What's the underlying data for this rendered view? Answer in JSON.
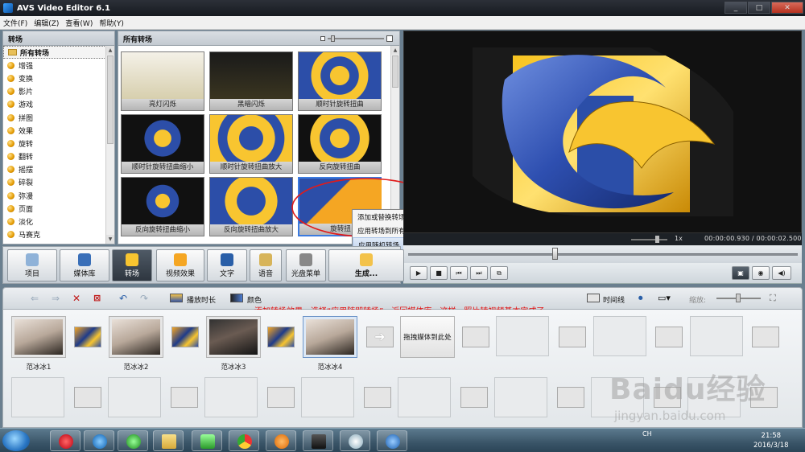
{
  "window": {
    "title": "AVS Video Editor 6.1"
  },
  "menu": [
    "文件(F)",
    "编辑(Z)",
    "查看(W)",
    "帮助(Y)"
  ],
  "left_panel": {
    "header": "转场",
    "categories": [
      "所有转场",
      "增强",
      "变换",
      "影片",
      "游戏",
      "拼图",
      "效果",
      "旋转",
      "翻转",
      "摇摆",
      "碎裂",
      "弥漫",
      "页面",
      "淡化",
      "马赛克"
    ]
  },
  "transitions_panel": {
    "header": "所有转场",
    "items": [
      "亮灯闪烁",
      "黑暗闪烁",
      "顺时针旋转扭曲",
      "顺时针旋转扭曲缩小",
      "顺时针旋转扭曲放大",
      "反向旋转扭曲",
      "反向旋转扭曲缩小",
      "反向旋转扭曲放大",
      "旋转扭"
    ]
  },
  "context_menu": {
    "items": [
      "添加或替换转场",
      "应用转场到所有的",
      "应用随机转场"
    ],
    "highlighted": 2
  },
  "preview": {
    "speed": "1x",
    "time_current": "00:00:00.930",
    "time_total": "00:00:02.500",
    "seek_fraction": 0.37
  },
  "mode_buttons": [
    {
      "label": "项目"
    },
    {
      "label": "媒体库"
    },
    {
      "label": "转场",
      "active": true
    },
    {
      "label": "视频效果"
    },
    {
      "label": "文字"
    },
    {
      "label": "语音"
    },
    {
      "label": "光盘菜单"
    },
    {
      "label": "生成..."
    }
  ],
  "playback_buttons": [
    "▶",
    "■",
    "⏮",
    "⏭",
    "⧉"
  ],
  "timeline_toolbar": {
    "duration_label": "播放时长",
    "color_label": "颜色",
    "timeline_label": "时间线",
    "zoom_label": "缩放:"
  },
  "annotation": "添加转场效果，选择“应用随即转场”，返回媒体库，这样，照片转视频基本完成了",
  "timeline": {
    "clips": [
      "范冰冰1",
      "范冰冰2",
      "范冰冰3",
      "范冰冰4"
    ],
    "drop_hint": "拖拽媒体到此处"
  },
  "watermark": {
    "main": "Baidu经验",
    "sub": "jingyan.baidu.com"
  },
  "taskbar": {
    "tray_text": "CH",
    "time": "21:58",
    "date": "2016/3/18"
  },
  "colors": {
    "accent_blue": "#2a5fa8",
    "annotation_red": "#e01010",
    "circle_red": "#e01b1b",
    "transition_yellow": "#f8c530",
    "transition_blue": "#2c4ea8"
  },
  "icons": [
    "app-icon",
    "folder-icon",
    "category-dot-icon",
    "back-arrow-icon",
    "forward-arrow-icon",
    "delete-icon",
    "undo-icon",
    "redo-icon",
    "film-icon",
    "monitor-icon",
    "speaker-icon",
    "camera-icon"
  ]
}
